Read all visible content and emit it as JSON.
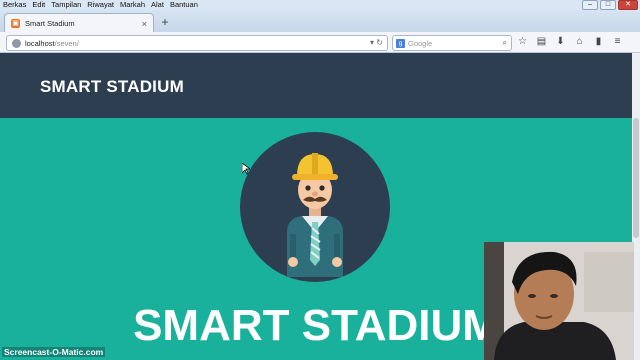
{
  "menu": [
    "Berkas",
    "Edit",
    "Tampilan",
    "Riwayat",
    "Markah",
    "Alat",
    "Bantuan"
  ],
  "tab": {
    "title": "Smart Stadium",
    "close": "×",
    "new": "+"
  },
  "url": {
    "host": "localhost",
    "path": "/seven/"
  },
  "search": {
    "placeholder": "Google"
  },
  "header": {
    "brand": "SMART STADIUM"
  },
  "hero": {
    "title": "SMART STADIUM"
  },
  "watermark": "Screencast-O-Matic.com",
  "colors": {
    "header": "#2c3e50",
    "hero": "#1ab19c",
    "circle": "#2c3e50"
  }
}
